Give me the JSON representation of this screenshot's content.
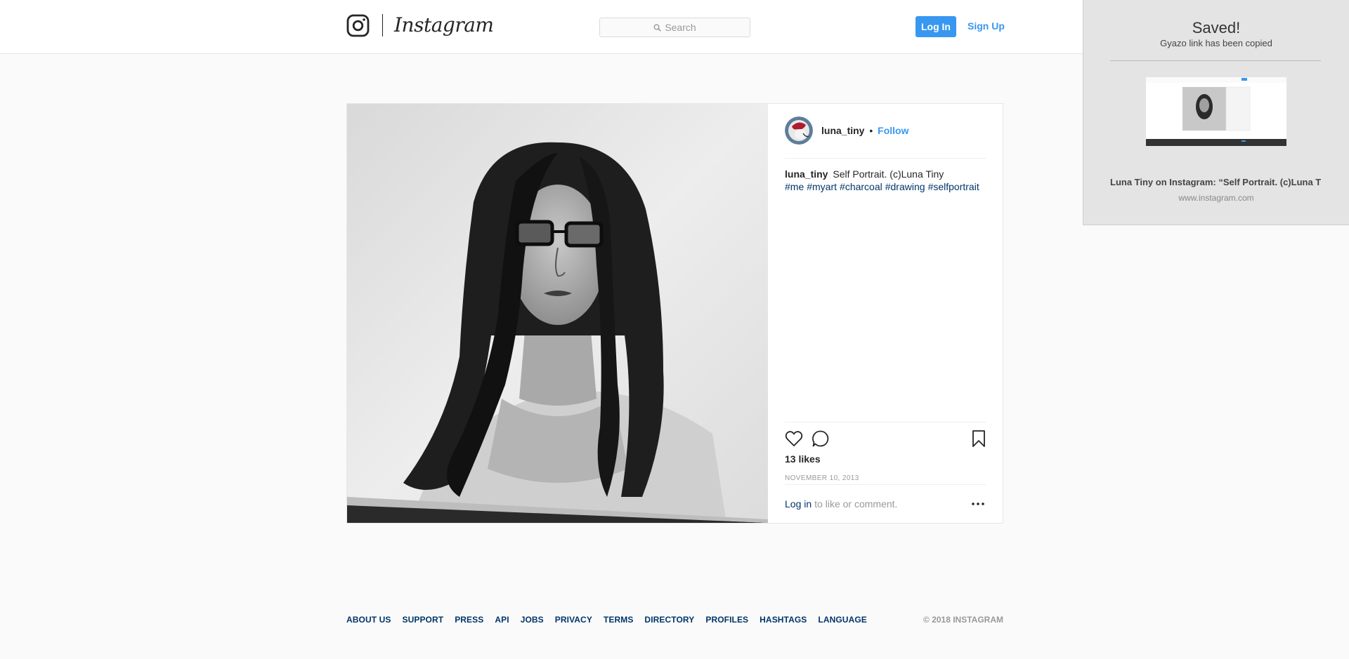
{
  "header": {
    "wordmark": "Instagram",
    "search_placeholder": "Search",
    "login_label": "Log In",
    "signup_label": "Sign Up",
    "accent_color": "#3897f0"
  },
  "post": {
    "username": "luna_tiny",
    "separator": "•",
    "follow_label": "Follow",
    "caption_text": "Self Portrait. (c)Luna Tiny",
    "hashtags": [
      "#me",
      "#myart",
      "#charcoal",
      "#drawing",
      "#selfportrait"
    ],
    "likes": "13 likes",
    "date": "NOVEMBER 10, 2013",
    "login_link": "Log in",
    "comment_hint": "to like or comment."
  },
  "footer": {
    "links": [
      "ABOUT US",
      "SUPPORT",
      "PRESS",
      "API",
      "JOBS",
      "PRIVACY",
      "TERMS",
      "DIRECTORY",
      "PROFILES",
      "HASHTAGS",
      "LANGUAGE"
    ],
    "copyright": "© 2018 INSTAGRAM"
  },
  "gyazo": {
    "title": "Saved!",
    "subtitle": "Gyazo link has been copied",
    "page_title": "Luna Tiny on Instagram: “Self Portrait. (c)Luna Tiny",
    "url": "www.instagram.com"
  },
  "icons": {
    "logo": "instagram-camera-icon",
    "search": "search-icon",
    "like": "heart-icon",
    "comment": "speech-bubble-icon",
    "save": "bookmark-icon",
    "more": "more-dots-icon"
  }
}
